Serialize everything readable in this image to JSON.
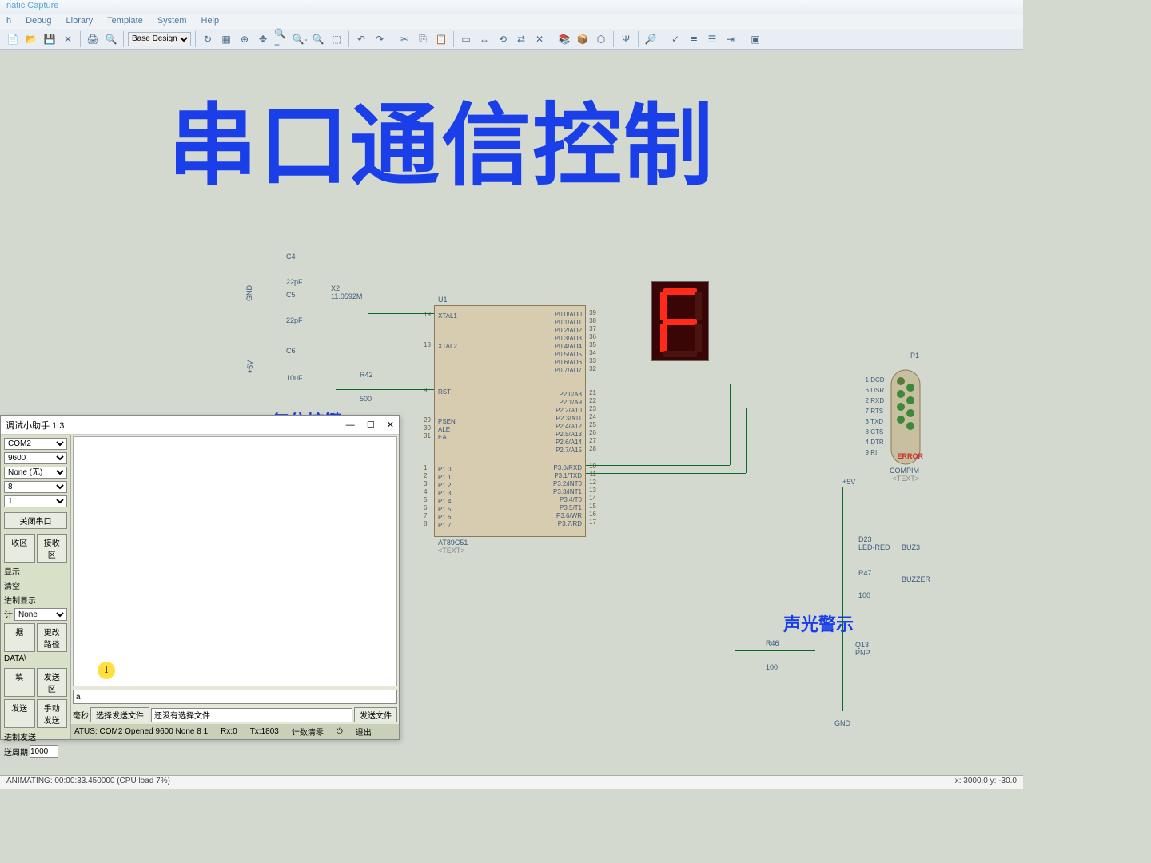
{
  "app": {
    "title": "natic Capture"
  },
  "menu": {
    "items": [
      "h",
      "Debug",
      "Library",
      "Template",
      "System",
      "Help"
    ]
  },
  "toolbar": {
    "design_selector": "Base Design"
  },
  "canvas": {
    "main_title": "串口通信控制",
    "reset_label": "复位控键",
    "alarm_label": "声光警示",
    "components": {
      "C4": {
        "name": "C4",
        "val": "22pF"
      },
      "C5": {
        "name": "C5",
        "val": "22pF"
      },
      "C6": {
        "name": "C6",
        "val": "10uF"
      },
      "X2": {
        "name": "X2",
        "val": "11.0592M"
      },
      "R42": {
        "name": "R42",
        "val": "500"
      },
      "U1": {
        "name": "U1",
        "part": "AT89C51",
        "text": "<TEXT>"
      },
      "P1": {
        "name": "P1",
        "part": "COMPIM",
        "text": "<TEXT>"
      },
      "D23": {
        "name": "D23",
        "part": "LED-RED"
      },
      "BUZ3": {
        "name": "BUZ3",
        "part": "BUZZER"
      },
      "R47": {
        "name": "R47",
        "val": "100"
      },
      "R46": {
        "name": "R46",
        "val": "100"
      },
      "Q13": {
        "name": "Q13",
        "part": "PNP"
      },
      "GND": "GND",
      "V5": "+5V",
      "ERROR": "ERROR"
    },
    "mcu_pins_left": [
      {
        "n": "19",
        "lbl": "XTAL1"
      },
      {
        "n": "18",
        "lbl": "XTAL2"
      },
      {
        "n": "9",
        "lbl": "RST"
      },
      {
        "n": "29",
        "lbl": "PSEN"
      },
      {
        "n": "30",
        "lbl": "ALE"
      },
      {
        "n": "31",
        "lbl": "EA"
      },
      {
        "n": "1",
        "lbl": "P1.0"
      },
      {
        "n": "2",
        "lbl": "P1.1"
      },
      {
        "n": "3",
        "lbl": "P1.2"
      },
      {
        "n": "4",
        "lbl": "P1.3"
      },
      {
        "n": "5",
        "lbl": "P1.4"
      },
      {
        "n": "6",
        "lbl": "P1.5"
      },
      {
        "n": "7",
        "lbl": "P1.6"
      },
      {
        "n": "8",
        "lbl": "P1.7"
      }
    ],
    "mcu_pins_right_p0": [
      {
        "n": "39",
        "lbl": "P0.0/AD0"
      },
      {
        "n": "38",
        "lbl": "P0.1/AD1"
      },
      {
        "n": "37",
        "lbl": "P0.2/AD2"
      },
      {
        "n": "36",
        "lbl": "P0.3/AD3"
      },
      {
        "n": "35",
        "lbl": "P0.4/AD4"
      },
      {
        "n": "34",
        "lbl": "P0.5/AD5"
      },
      {
        "n": "33",
        "lbl": "P0.6/AD6"
      },
      {
        "n": "32",
        "lbl": "P0.7/AD7"
      }
    ],
    "mcu_pins_right_p2": [
      {
        "n": "21",
        "lbl": "P2.0/A8"
      },
      {
        "n": "22",
        "lbl": "P2.1/A9"
      },
      {
        "n": "23",
        "lbl": "P2.2/A10"
      },
      {
        "n": "24",
        "lbl": "P2.3/A11"
      },
      {
        "n": "25",
        "lbl": "P2.4/A12"
      },
      {
        "n": "26",
        "lbl": "P2.5/A13"
      },
      {
        "n": "27",
        "lbl": "P2.6/A14"
      },
      {
        "n": "28",
        "lbl": "P2.7/A15"
      }
    ],
    "mcu_pins_right_p3": [
      {
        "n": "10",
        "lbl": "P3.0/RXD"
      },
      {
        "n": "11",
        "lbl": "P3.1/TXD"
      },
      {
        "n": "12",
        "lbl": "P3.2/INT0"
      },
      {
        "n": "13",
        "lbl": "P3.3/INT1"
      },
      {
        "n": "14",
        "lbl": "P3.4/T0"
      },
      {
        "n": "15",
        "lbl": "P3.5/T1"
      },
      {
        "n": "16",
        "lbl": "P3.6/WR"
      },
      {
        "n": "17",
        "lbl": "P3.7/RD"
      }
    ],
    "conn_pins": [
      {
        "n": "1",
        "lbl": "DCD"
      },
      {
        "n": "6",
        "lbl": "DSR"
      },
      {
        "n": "2",
        "lbl": "RXD"
      },
      {
        "n": "7",
        "lbl": "RTS"
      },
      {
        "n": "3",
        "lbl": "TXD"
      },
      {
        "n": "8",
        "lbl": "CTS"
      },
      {
        "n": "4",
        "lbl": "DTR"
      },
      {
        "n": "9",
        "lbl": "RI"
      }
    ]
  },
  "serial": {
    "title": "调试小助手 1.3",
    "port": "COM2",
    "baud": "9600",
    "parity": "None (无)",
    "databits": "8",
    "stopbits": "1",
    "btn_close": "关闭串口",
    "btn_rx_area": "收区",
    "btn_rx": "接收区",
    "lbl_show": "显示",
    "lbl_clear": "清空",
    "lbl_hex_show": "进制显示",
    "lbl_stat": "计",
    "sel_none": "None",
    "btn_data": "据",
    "btn_path": "更改路径",
    "lbl_data": "DATA\\",
    "btn_fill": "填",
    "btn_tx_area": "发送区",
    "btn_send": "发送",
    "btn_manual": "手动发送",
    "lbl_hex_send": "进制发送",
    "lbl_period": "送周期",
    "period_val": "1000",
    "lbl_ms": "毫秒",
    "btn_choose_file": "选择发送文件",
    "file_status": "还没有选择文件",
    "btn_send_file": "发送文件",
    "status": "ATUS: COM2 Opened 9600 None  8 1",
    "rx_label": "Rx:0",
    "tx_label": "Tx:1803",
    "btn_counter_clear": "计数清零",
    "btn_exit": "退出",
    "tx_value": "a"
  },
  "statusbar": {
    "anim": "ANIMATING: 00:00:33.450000 (CPU load 7%)",
    "coords": "x:    3000.0   y:     -30.0"
  }
}
